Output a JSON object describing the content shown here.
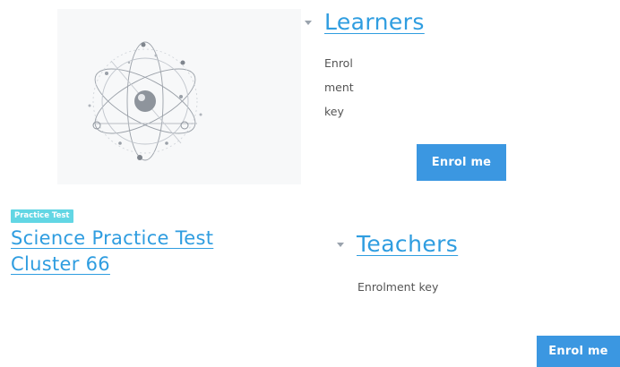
{
  "colors": {
    "link": "#2f9de0",
    "button_bg": "#3b97e1",
    "badge_bg": "#62d6e4",
    "text": "#555555"
  },
  "course": {
    "image_icon": "atom-icon",
    "badge": "Practice Test",
    "title_line1": "Science Practice Test",
    "title_line2": "Cluster 66"
  },
  "learners": {
    "title": "Learners",
    "key_line1": "Enrol",
    "key_line2": "ment",
    "key_line3": "key",
    "button": "Enrol me"
  },
  "teachers": {
    "title": "Teachers",
    "key_label": "Enrolment key",
    "button": "Enrol me"
  }
}
